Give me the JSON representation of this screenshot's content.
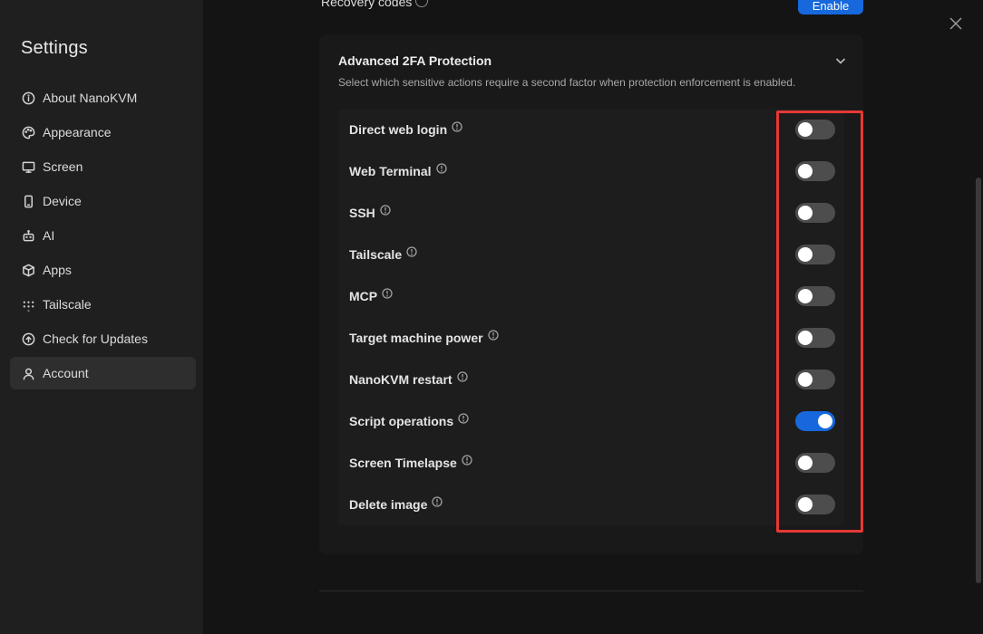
{
  "sidebar": {
    "title": "Settings",
    "items": [
      {
        "label": "About NanoKVM",
        "icon": "info-circle-icon"
      },
      {
        "label": "Appearance",
        "icon": "palette-icon"
      },
      {
        "label": "Screen",
        "icon": "monitor-icon"
      },
      {
        "label": "Device",
        "icon": "phone-icon"
      },
      {
        "label": "AI",
        "icon": "robot-icon"
      },
      {
        "label": "Apps",
        "icon": "box-icon"
      },
      {
        "label": "Tailscale",
        "icon": "tailscale-icon"
      },
      {
        "label": "Check for Updates",
        "icon": "arrow-up-circle-icon"
      },
      {
        "label": "Account",
        "icon": "user-icon",
        "active": true
      }
    ]
  },
  "top": {
    "recovery_label": "Recovery codes",
    "enable_label": "Enable"
  },
  "card": {
    "title": "Advanced 2FA Protection",
    "description": "Select which sensitive actions require a second factor when protection enforcement is enabled."
  },
  "actions": [
    {
      "label": "Direct web login",
      "enabled": false
    },
    {
      "label": "Web Terminal",
      "enabled": false
    },
    {
      "label": "SSH",
      "enabled": false
    },
    {
      "label": "Tailscale",
      "enabled": false
    },
    {
      "label": "MCP",
      "enabled": false
    },
    {
      "label": "Target machine power",
      "enabled": false
    },
    {
      "label": "NanoKVM restart",
      "enabled": false
    },
    {
      "label": "Script operations",
      "enabled": true
    },
    {
      "label": "Screen Timelapse",
      "enabled": false
    },
    {
      "label": "Delete image",
      "enabled": false
    }
  ],
  "colors": {
    "accent": "#1668dc",
    "highlight": "#e53935",
    "toggle_off": "#4d4d4d"
  }
}
